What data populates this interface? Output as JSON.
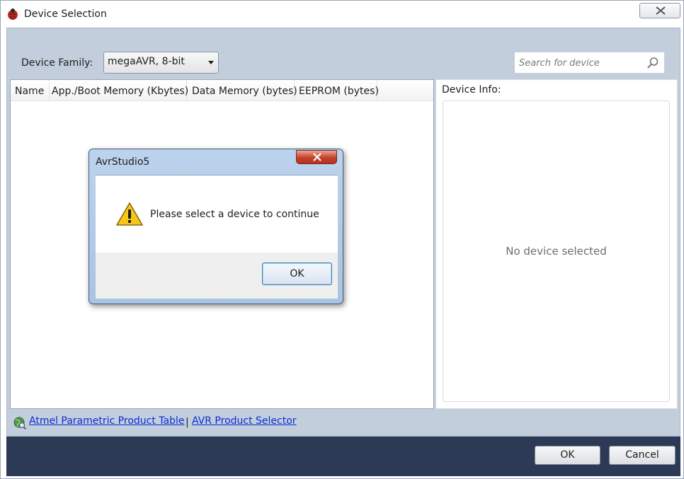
{
  "window": {
    "title": "Device Selection"
  },
  "toolbar": {
    "family_label": "Device Family:",
    "family_value": "megaAVR, 8-bit",
    "search_placeholder": "Search for device"
  },
  "table": {
    "columns": [
      "Name",
      "App./Boot Memory (Kbytes)",
      "Data Memory (bytes)",
      "EEPROM (bytes)"
    ]
  },
  "device_info": {
    "label": "Device Info:",
    "empty_text": "No device selected"
  },
  "links": {
    "parametric": "Atmel Parametric Product Table",
    "separator": "|",
    "selector": "AVR Product Selector"
  },
  "footer": {
    "ok_label": "OK",
    "cancel_label": "Cancel"
  },
  "message_box": {
    "title": "AvrStudio5",
    "text": "Please select a device to continue",
    "ok_label": "OK"
  },
  "colors": {
    "body_bg": "#c2cedc",
    "footer_bg": "#2c3a55",
    "link": "#0b2cd6",
    "msg_close": "#c4412a"
  }
}
